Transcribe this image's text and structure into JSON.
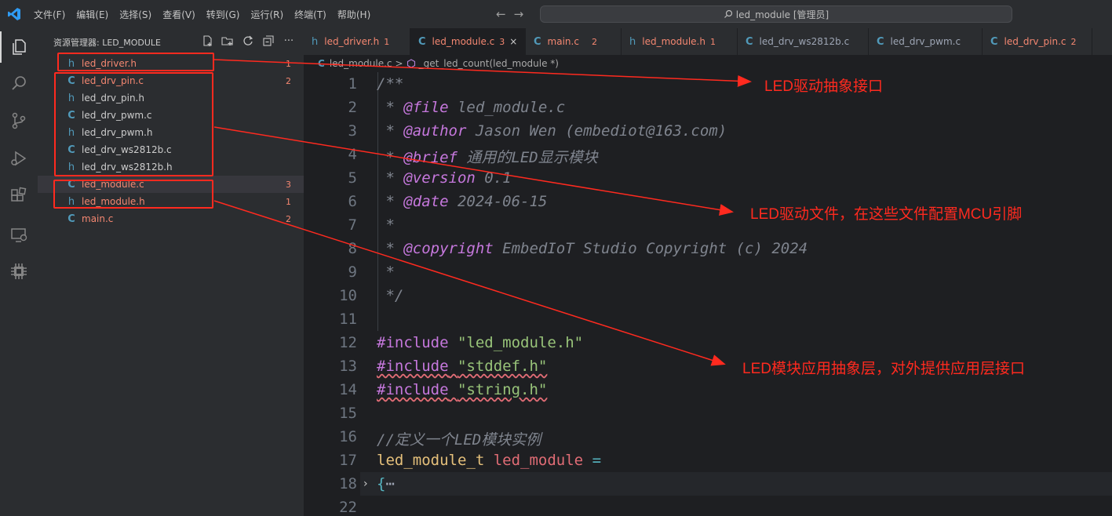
{
  "menu": [
    "文件(F)",
    "编辑(E)",
    "选择(S)",
    "查看(V)",
    "转到(G)",
    "运行(R)",
    "终端(T)",
    "帮助(H)"
  ],
  "search": {
    "text": "led_module [管理员]"
  },
  "explorer": {
    "title": "资源管理器: LED_MODULE",
    "files": [
      {
        "icon": "h",
        "name": "led_driver.h",
        "badge": "1",
        "error": true
      },
      {
        "icon": "C",
        "name": "led_drv_pin.c",
        "badge": "2",
        "error": true
      },
      {
        "icon": "h",
        "name": "led_drv_pin.h",
        "badge": "",
        "error": false
      },
      {
        "icon": "C",
        "name": "led_drv_pwm.c",
        "badge": "",
        "error": false
      },
      {
        "icon": "h",
        "name": "led_drv_pwm.h",
        "badge": "",
        "error": false
      },
      {
        "icon": "C",
        "name": "led_drv_ws2812b.c",
        "badge": "",
        "error": false
      },
      {
        "icon": "h",
        "name": "led_drv_ws2812b.h",
        "badge": "",
        "error": false
      },
      {
        "icon": "C",
        "name": "led_module.c",
        "badge": "3",
        "error": true
      },
      {
        "icon": "h",
        "name": "led_module.h",
        "badge": "1",
        "error": true
      },
      {
        "icon": "C",
        "name": "main.c",
        "badge": "2",
        "error": true
      }
    ]
  },
  "tabs": [
    {
      "icon": "h",
      "label": "led_driver.h",
      "badge": "1",
      "error": true
    },
    {
      "icon": "C",
      "label": "led_module.c",
      "badge": "3",
      "error": true,
      "active": true,
      "close": "×"
    },
    {
      "icon": "C",
      "label": "main.c",
      "badge": "2",
      "error": true
    },
    {
      "icon": "h",
      "label": "led_module.h",
      "badge": "1",
      "error": true
    },
    {
      "icon": "C",
      "label": "led_drv_ws2812b.c",
      "badge": "",
      "error": false
    },
    {
      "icon": "C",
      "label": "led_drv_pwm.c",
      "badge": "",
      "error": false
    },
    {
      "icon": "C",
      "label": "led_drv_pin.c",
      "badge": "2",
      "error": true
    }
  ],
  "breadcrumb": {
    "file": "led_module.c",
    "sep": ">",
    "symbol": "_get_led_count(led_module *)"
  },
  "code_lines": [
    {
      "n": "1",
      "text": "/**"
    },
    {
      "n": "2",
      "tag": "@file",
      "rest": " led_module.c"
    },
    {
      "n": "3",
      "tag": "@author",
      "rest": " Jason Wen (embediot@163.com)"
    },
    {
      "n": "4",
      "tag": "@brief",
      "rest": " 通用的LED显示模块"
    },
    {
      "n": "5",
      "tag": "@version",
      "rest": " 0.1"
    },
    {
      "n": "6",
      "tag": "@date",
      "rest": " 2024-06-15"
    },
    {
      "n": "7",
      "text": " *"
    },
    {
      "n": "8",
      "tag": "@copyright",
      "rest": " EmbedIoT Studio Copyright (c) 2024"
    },
    {
      "n": "9",
      "text": " *"
    },
    {
      "n": "10",
      "text": " */"
    },
    {
      "n": "11",
      "text": ""
    },
    {
      "n": "12",
      "kw": "#include",
      "str": "\"led_module.h\""
    },
    {
      "n": "13",
      "kw": "#include",
      "str": "\"stddef.h\""
    },
    {
      "n": "14",
      "kw": "#include",
      "str": "\"string.h\""
    },
    {
      "n": "15",
      "text": ""
    },
    {
      "n": "16",
      "text": "//定义一个LED模块实例"
    },
    {
      "n": "17",
      "type": "led_module_t",
      "var": "led_module",
      "op": "="
    },
    {
      "n": "18",
      "brace": "{",
      "dots": "⋯"
    },
    {
      "n": "22",
      "text": ""
    }
  ],
  "annotations": [
    "LED驱动抽象接口",
    "LED驱动文件，在这些文件配置MCU引脚",
    "LED模块应用抽象层，对外提供应用层接口"
  ],
  "colors": {
    "annotation": "#ff2a1f",
    "error": "#f48771",
    "c_icon": "#519aba"
  }
}
